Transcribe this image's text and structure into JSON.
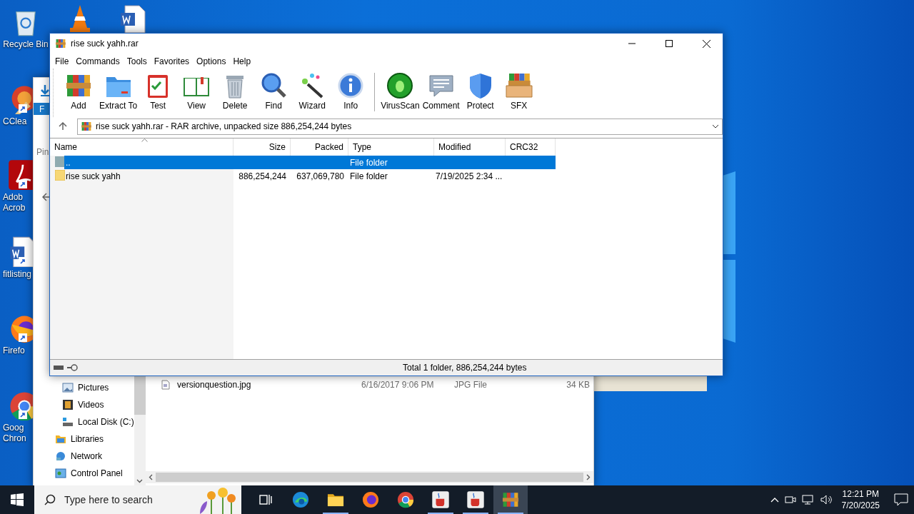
{
  "desktop_icons": [
    {
      "label_lines": [
        "Recycle Bin"
      ]
    },
    {
      "label_lines": [
        "CClea"
      ]
    },
    {
      "label_lines": [
        "Adob",
        "Acrob"
      ]
    },
    {
      "label_lines": [
        "fitlisting"
      ]
    },
    {
      "label_lines": [
        "Firefo"
      ]
    },
    {
      "label_lines": [
        "Goog",
        "Chron"
      ]
    }
  ],
  "explorer": {
    "ribbon_tab": "F",
    "pinned_label": "Pin",
    "this_pc_children": [
      {
        "label": "Pictures"
      },
      {
        "label": "Videos"
      },
      {
        "label": "Local Disk (C:)"
      }
    ],
    "nav_items": [
      {
        "label": "Libraries"
      },
      {
        "label": "Network"
      },
      {
        "label": "Control Panel"
      }
    ],
    "files": [
      {
        "name": "versionquestion.jpg",
        "modified": "6/16/2017 9:06 PM",
        "type": "JPG File",
        "size": "34 KB"
      }
    ]
  },
  "winrar": {
    "title": "rise suck yahh.rar",
    "menu": [
      "File",
      "Commands",
      "Tools",
      "Favorites",
      "Options",
      "Help"
    ],
    "toolbar_groups": [
      {
        "buttons": [
          {
            "label": "Add"
          },
          {
            "label": "Extract To"
          },
          {
            "label": "Test"
          },
          {
            "label": "View"
          },
          {
            "label": "Delete"
          },
          {
            "label": "Find"
          },
          {
            "label": "Wizard"
          },
          {
            "label": "Info"
          }
        ]
      },
      {
        "buttons": [
          {
            "label": "VirusScan"
          },
          {
            "label": "Comment"
          },
          {
            "label": "Protect"
          },
          {
            "label": "SFX"
          }
        ]
      }
    ],
    "address": "rise suck yahh.rar - RAR archive, unpacked size 886,254,244 bytes",
    "columns": [
      {
        "label": "Name",
        "sorted": true
      },
      {
        "label": "Size",
        "sorted": false
      },
      {
        "label": "Packed",
        "sorted": false
      },
      {
        "label": "Type",
        "sorted": false
      },
      {
        "label": "Modified",
        "sorted": false
      },
      {
        "label": "CRC32",
        "sorted": false
      }
    ],
    "rows": [
      {
        "kind": "parent",
        "name": "..",
        "type": "File folder",
        "selected": true
      },
      {
        "kind": "folder",
        "name": "rise suck yahh",
        "size": "886,254,244",
        "packed": "637,069,780",
        "type": "File folder",
        "modified": "7/19/2025 2:34 ...",
        "selected": false
      }
    ],
    "status": "Total 1 folder, 886,254,244 bytes"
  },
  "taskbar": {
    "search_placeholder": "Type here to search",
    "apps": [
      {
        "running": false,
        "selected": false
      },
      {
        "running": false,
        "selected": false
      },
      {
        "running": true,
        "selected": false
      },
      {
        "running": false,
        "selected": false
      },
      {
        "running": false,
        "selected": false
      },
      {
        "running": true,
        "selected": false
      },
      {
        "running": true,
        "selected": false
      },
      {
        "running": true,
        "selected": true
      }
    ],
    "clock": {
      "time": "12:21 PM",
      "date": "7/20/2025"
    }
  }
}
